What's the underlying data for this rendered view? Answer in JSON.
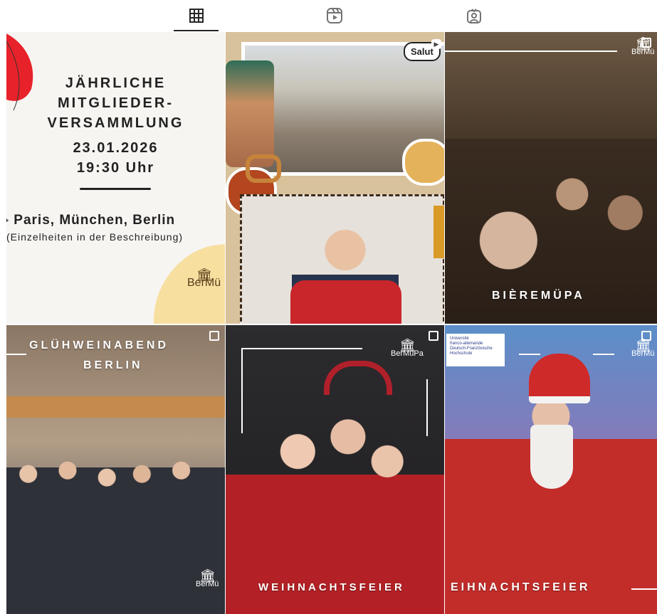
{
  "tabs": [
    {
      "label": "Posts",
      "icon": "grid-icon",
      "active": true
    },
    {
      "label": "Reels",
      "icon": "reels-icon",
      "active": false
    },
    {
      "label": "Tagged",
      "icon": "tagged-icon",
      "active": false
    }
  ],
  "posts": {
    "p1": {
      "title_line1": "JÄHRLICHE",
      "title_line2": "MITGLIEDER-",
      "title_line3": "VERSAMMLUNG",
      "date": "23.01.2026",
      "time": "19:30 Uhr",
      "cities": "Paris, München, Berlin",
      "details": "(Einzelheiten in der Beschreibung)",
      "logo_text": "BerMü"
    },
    "p2": {
      "bubble": "Salut"
    },
    "p3": {
      "caption": "BIÈREMÜPA",
      "logo_text": "BerMü"
    },
    "p4": {
      "caption_line1": "GLÜHWEINABEND",
      "caption_line2": "BERLIN",
      "logo_text": "BerMü"
    },
    "p5": {
      "caption": "WEIHNACHTSFEIER",
      "logo_text": "BerMüPa"
    },
    "p6": {
      "caption": "EIHNACHTSFEIER",
      "uni_line1": "Université",
      "uni_line2": "franco-allemande",
      "uni_line3": "Deutsch-Französische",
      "uni_line4": "Hochschule",
      "logo_text": "BerMü"
    }
  }
}
